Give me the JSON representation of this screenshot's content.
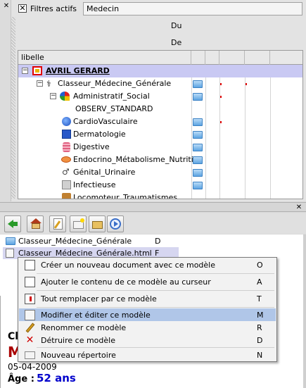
{
  "filters": {
    "active_label": "Filtres actifs",
    "filter_value": "Medecin",
    "date_from_label": "Du",
    "date_to_label": "De"
  },
  "grid": {
    "header_label": "libelle",
    "rows": [
      {
        "label": "AVRIL GERARD"
      },
      {
        "label": "Classeur_Médecine_Générale"
      },
      {
        "label": "Administratif_Social"
      },
      {
        "label": "OBSERV_STANDARD"
      },
      {
        "label": "CardioVasculaire"
      },
      {
        "label": "Dermatologie"
      },
      {
        "label": "Digestive"
      },
      {
        "label": "Endocrino_Métabolisme_Nutrition"
      },
      {
        "label": "Génital_Urinaire"
      },
      {
        "label": "Infectieuse"
      },
      {
        "label": "Locomoteur_Traumatismes"
      }
    ]
  },
  "files": [
    {
      "name": "Classeur_Médecine_Générale",
      "flag": "D"
    },
    {
      "name": "Classeur_Médecine_Générale.html",
      "flag": "F"
    }
  ],
  "context_menu": {
    "items": [
      {
        "label": "Créer un nouveau document avec ce modèle",
        "key": "O"
      },
      {
        "label": "Ajouter le contenu de ce modèle au curseur",
        "key": "A"
      },
      {
        "label": "Tout remplacer par ce modèle",
        "key": "T"
      },
      {
        "label": "Modifier et éditer ce modèle",
        "key": "M"
      },
      {
        "label": "Renommer ce modèle",
        "key": "R"
      },
      {
        "label": "Détruire ce modèle",
        "key": "D"
      },
      {
        "label": "Nouveau répertoire",
        "key": "N"
      }
    ]
  },
  "document": {
    "heading_fragment": "Cl",
    "big_letter": "M",
    "date": "05-04-2009",
    "age_label": "Âge :",
    "age_value": "52 ans"
  },
  "colors": {
    "selection": "#c9c9f3",
    "menu_highlight": "#b0c6e8",
    "patient_red": "#aa0000",
    "age_blue": "#0000cc"
  }
}
